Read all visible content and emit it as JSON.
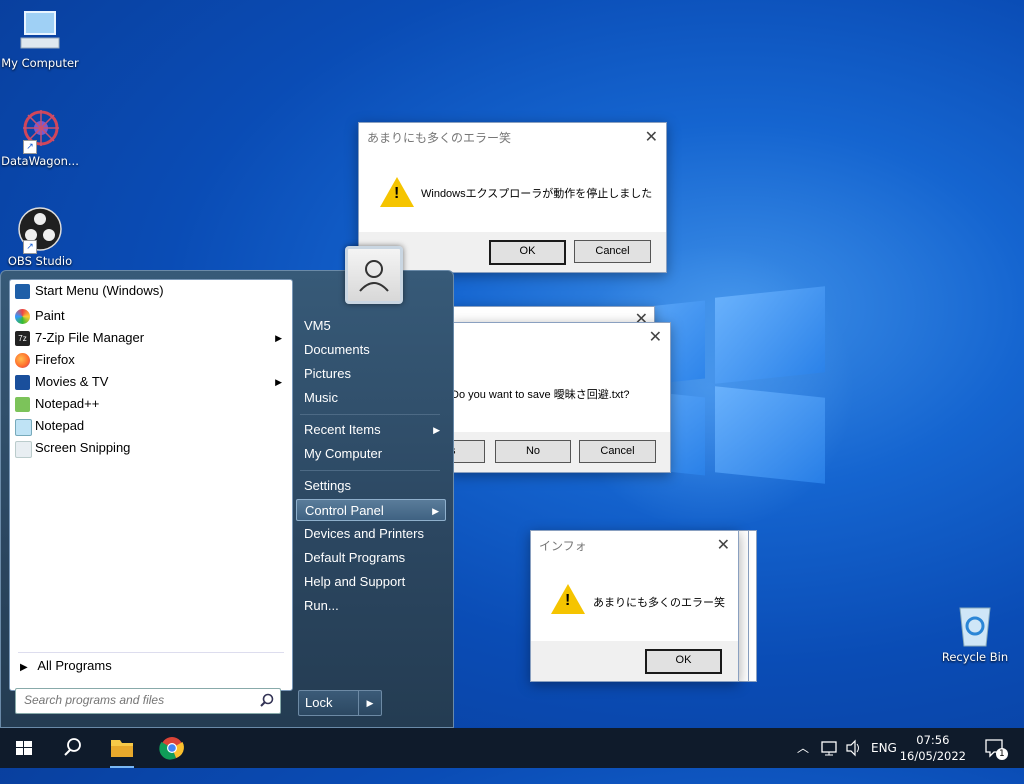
{
  "desktop": {
    "icons": [
      {
        "label": "My Computer"
      },
      {
        "label": "DataWagon..."
      },
      {
        "label": "OBS Studio"
      },
      {
        "label": "Recycle Bin"
      }
    ]
  },
  "dialogs": {
    "explorer_error": {
      "title": "あまりにも多くのエラー笑",
      "message": "Windowsエクスプローラが動作を停止しました",
      "ok": "OK",
      "cancel": "Cancel"
    },
    "save_prompt": {
      "message": "Do you want to save 曖昧さ回避.txt?",
      "yes": "s",
      "no": "No",
      "cancel": "Cancel"
    },
    "info": {
      "title": "インフォ",
      "message": "あまりにも多くのエラー笑",
      "ok": "OK"
    }
  },
  "start_menu": {
    "programs": [
      {
        "label": "Start Menu (Windows)",
        "icon": "start-menu-icon"
      },
      {
        "label": "Paint",
        "icon": "paint-icon"
      },
      {
        "label": "7-Zip File Manager",
        "icon": "7zip-icon",
        "submenu": true
      },
      {
        "label": "Firefox",
        "icon": "firefox-icon"
      },
      {
        "label": "Movies & TV",
        "icon": "movies-tv-icon",
        "submenu": true
      },
      {
        "label": "Notepad++",
        "icon": "notepadpp-icon"
      },
      {
        "label": "Notepad",
        "icon": "notepad-icon"
      },
      {
        "label": "Screen Snipping",
        "icon": "snipping-icon"
      }
    ],
    "all_programs": "All Programs",
    "search_placeholder": "Search programs and files",
    "right_items": [
      {
        "label": "VM5"
      },
      {
        "label": "Documents"
      },
      {
        "label": "Pictures"
      },
      {
        "label": "Music"
      },
      {
        "label": "Recent Items",
        "submenu": true
      },
      {
        "label": "My Computer"
      },
      {
        "label": "Settings"
      },
      {
        "label": "Control Panel",
        "submenu": true,
        "highlighted": true
      },
      {
        "label": "Devices and Printers"
      },
      {
        "label": "Default Programs"
      },
      {
        "label": "Help and Support"
      },
      {
        "label": "Run..."
      }
    ],
    "lock": "Lock"
  },
  "taskbar": {
    "language": "ENG",
    "time": "07:56",
    "date": "16/05/2022",
    "notifications": "1"
  },
  "colors": {
    "desktop_blue": "#0a4cb5",
    "taskbar": "#0f1b2b",
    "warning_yellow": "#f5c400"
  }
}
